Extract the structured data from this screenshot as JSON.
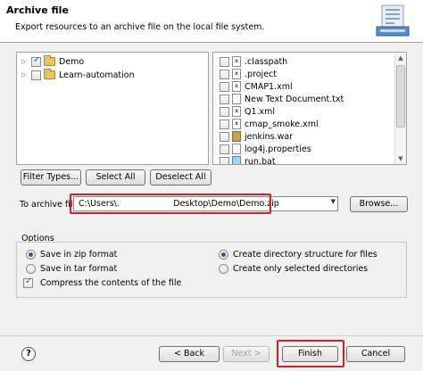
{
  "header": {
    "title": "Archive file",
    "description": "Export resources to an archive file on the local file system."
  },
  "tree": {
    "items": [
      {
        "label": "Demo",
        "checked": true
      },
      {
        "label": "Learn-automation",
        "checked": false
      }
    ]
  },
  "files": {
    "items": [
      {
        "label": ".classpath",
        "icon": "xml-file-icon"
      },
      {
        "label": ".project",
        "icon": "xml-file-icon"
      },
      {
        "label": "CMAP1.xml",
        "icon": "xml-file-icon"
      },
      {
        "label": "New Text Document.txt",
        "icon": "text-file-icon"
      },
      {
        "label": "Q1.xml",
        "icon": "xml-file-icon"
      },
      {
        "label": "cmap_smoke.xml",
        "icon": "xml-file-icon"
      },
      {
        "label": "jenkins.war",
        "icon": "jar-file-icon"
      },
      {
        "label": "log4j.properties",
        "icon": "text-file-icon"
      },
      {
        "label": "run.bat",
        "icon": "bat-file-icon"
      }
    ]
  },
  "buttons": {
    "filter_types": "Filter Types...",
    "select_all": "Select All",
    "deselect_all": "Deselect All",
    "browse": "Browse...",
    "back": "< Back",
    "next": "Next >",
    "finish": "Finish",
    "cancel": "Cancel"
  },
  "archive": {
    "label": "To archive file:",
    "value": "C:\\Users\\.                    Desktop\\Demo\\Demo.zip"
  },
  "options": {
    "label": "Options",
    "save_zip": "Save in zip format",
    "save_tar": "Save in tar format",
    "compress": "Compress the contents of the file",
    "create_dir": "Create directory structure for files",
    "create_selected": "Create only selected directories"
  },
  "colors": {
    "highlight": "#d0202a"
  }
}
